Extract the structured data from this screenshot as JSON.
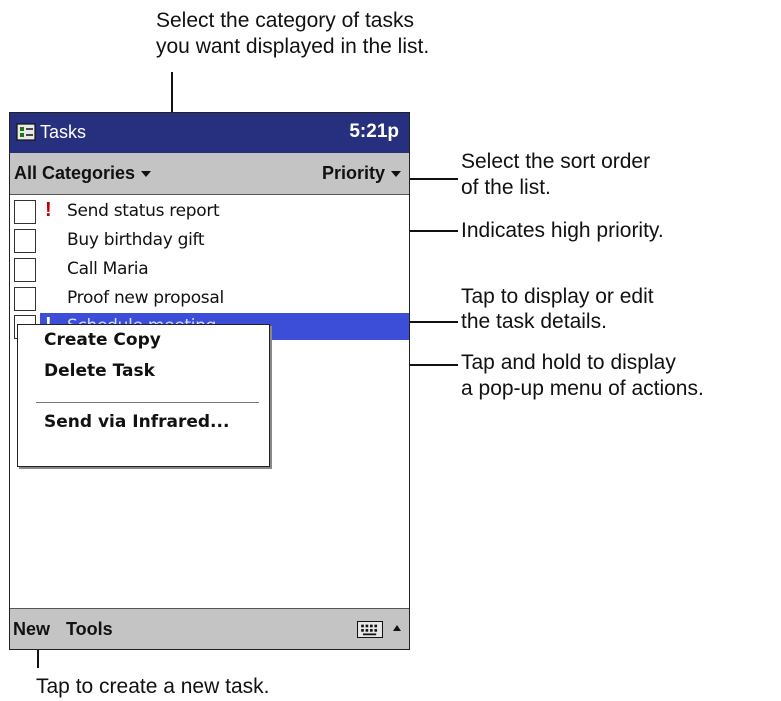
{
  "app": {
    "title": "Tasks",
    "time": "5:21p"
  },
  "filter": {
    "category": "All Categories",
    "sort": "Priority"
  },
  "tasks": [
    {
      "label": "Send status report",
      "priority": "!"
    },
    {
      "label": "Buy birthday gift",
      "priority": ""
    },
    {
      "label": "Call Maria",
      "priority": ""
    },
    {
      "label": "Proof new proposal",
      "priority": ""
    },
    {
      "label": "Schedule meeting",
      "priority": "!"
    }
  ],
  "context_menu": {
    "items": [
      "Create Copy",
      "Delete Task",
      "Send via Infrared..."
    ]
  },
  "bottombar": {
    "new": "New",
    "tools": "Tools"
  },
  "callouts": {
    "category_1": "Select the category of tasks",
    "category_2": "you want displayed in the list.",
    "sort_1": "Select the sort order",
    "sort_2": "of the list.",
    "priority": "Indicates high priority.",
    "details_1": "Tap to display or edit",
    "details_2": "the task details.",
    "popup_1": "Tap and hold to display",
    "popup_2": "a pop-up menu of actions.",
    "new_task": "Tap to create a new task."
  },
  "colors": {
    "titlebar": "#27307f",
    "selection": "#3c4ed8",
    "bar_gray": "#c4c4c4",
    "priority_mark": "#c00000"
  },
  "icons": [
    "tasks-app-icon",
    "keyboard-icon",
    "sip-arrow-up-icon",
    "dropdown-caret-icon"
  ]
}
